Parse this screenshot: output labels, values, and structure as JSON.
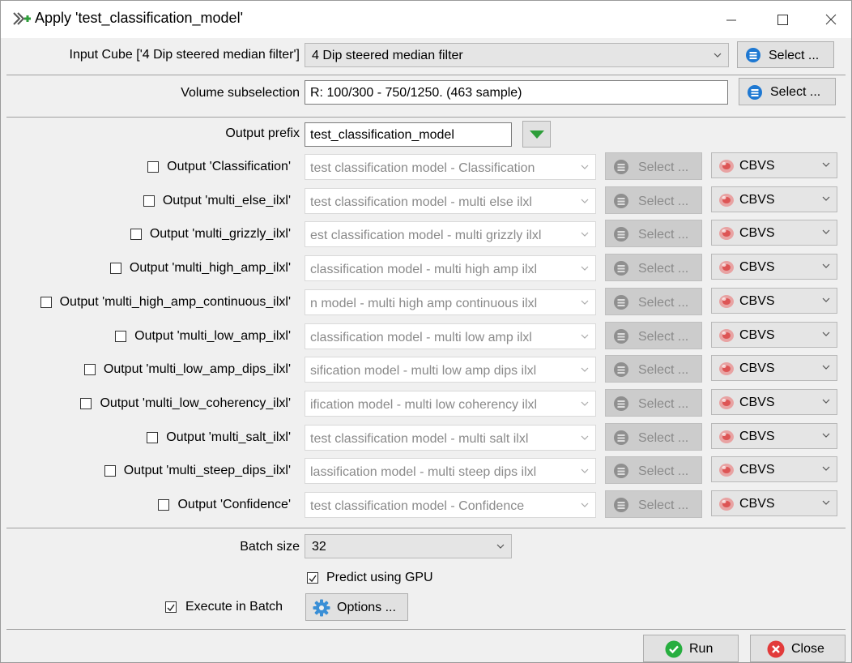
{
  "window": {
    "title": "Apply 'test_classification_model'"
  },
  "input_cube": {
    "label": "Input Cube ['4 Dip steered median filter']",
    "value": "4 Dip steered median filter",
    "select_label": "Select ..."
  },
  "volume": {
    "label": "Volume subselection",
    "value": "R: 100/300 - 750/1250.  (463 sample)",
    "select_label": "Select ..."
  },
  "output_prefix": {
    "label": "Output prefix",
    "value": "test_classification_model"
  },
  "outputs": [
    {
      "label": "Output 'Classification'",
      "name": "test  classification  model - Classification",
      "select": "Select ...",
      "format": "CBVS"
    },
    {
      "label": "Output 'multi_else_ilxl'",
      "name": "test  classification  model - multi  else  ilxl",
      "select": "Select ...",
      "format": "CBVS"
    },
    {
      "label": "Output 'multi_grizzly_ilxl'",
      "name": "est  classification  model - multi  grizzly  ilxl",
      "select": "Select ...",
      "format": "CBVS"
    },
    {
      "label": "Output 'multi_high_amp_ilxl'",
      "name": "classification  model - multi  high  amp  ilxl",
      "select": "Select ...",
      "format": "CBVS"
    },
    {
      "label": "Output 'multi_high_amp_continuous_ilxl'",
      "name": "n  model - multi  high  amp  continuous  ilxl",
      "select": "Select ...",
      "format": "CBVS"
    },
    {
      "label": "Output 'multi_low_amp_ilxl'",
      "name": "classification  model - multi  low  amp  ilxl",
      "select": "Select ...",
      "format": "CBVS"
    },
    {
      "label": "Output 'multi_low_amp_dips_ilxl'",
      "name": "sification  model - multi  low  amp  dips  ilxl",
      "select": "Select ...",
      "format": "CBVS"
    },
    {
      "label": "Output 'multi_low_coherency_ilxl'",
      "name": "ification  model - multi  low  coherency  ilxl",
      "select": "Select ...",
      "format": "CBVS"
    },
    {
      "label": "Output 'multi_salt_ilxl'",
      "name": "test  classification  model - multi  salt  ilxl",
      "select": "Select ...",
      "format": "CBVS"
    },
    {
      "label": "Output 'multi_steep_dips_ilxl'",
      "name": "lassification  model - multi  steep  dips  ilxl",
      "select": "Select ...",
      "format": "CBVS"
    },
    {
      "label": "Output 'Confidence'",
      "name": "test  classification  model - Confidence",
      "select": "Select ...",
      "format": "CBVS"
    }
  ],
  "batch_size": {
    "label": "Batch size",
    "value": "32"
  },
  "predict_gpu": {
    "label": "Predict using GPU",
    "checked": true
  },
  "execute_batch": {
    "label": "Execute in Batch",
    "checked": true,
    "options_label": "Options ..."
  },
  "footer": {
    "run_label": "Run",
    "close_label": "Close"
  }
}
